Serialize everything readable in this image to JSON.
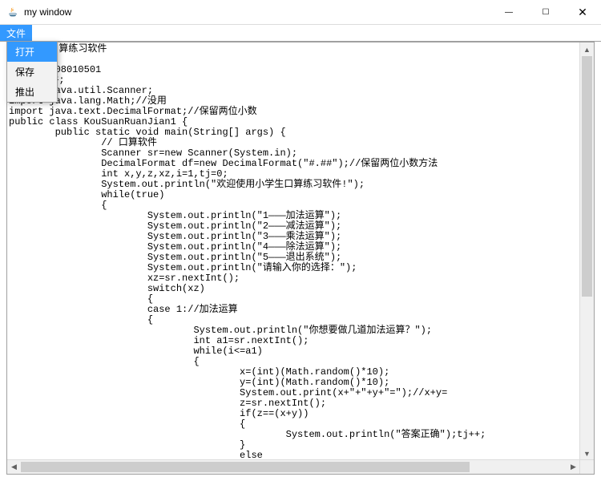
{
  "titlebar": {
    "title": "my window"
  },
  "window_controls": {
    "minimize": "—",
    "maximize": "☐",
    "close": "✕"
  },
  "menubar": {
    "file_label": "文件"
  },
  "dropdown": {
    "open": "打开",
    "save": "保存",
    "exit": "推出"
  },
  "code_text": "//小学生口算练习软件\n//杨子龙\n//20150508010501\n//口算软件;\nimport java.util.Scanner;\nimport java.lang.Math;//没用\nimport java.text.DecimalFormat;//保留两位小数\npublic class KouSuanRuanJian1 {\n        public static void main(String[] args) {\n                // 口算软件\n                Scanner sr=new Scanner(System.in);\n                DecimalFormat df=new DecimalFormat(\"#.##\");//保留两位小数方法\n                int x,y,z,xz,i=1,tj=0;\n                System.out.println(\"欢迎使用小学生口算练习软件!\");\n                while(true)\n                {\n                        System.out.println(\"1———加法运算\");\n                        System.out.println(\"2———减法运算\");\n                        System.out.println(\"3———乘法运算\");\n                        System.out.println(\"4———除法运算\");\n                        System.out.println(\"5———退出系统\");\n                        System.out.println(\"请输入你的选择：\");\n                        xz=sr.nextInt();\n                        switch(xz)\n                        {\n                        case 1://加法运算\n                        {\n                                System.out.println(\"你想要做几道加法运算？\");\n                                int a1=sr.nextInt();\n                                while(i<=a1)\n                                {\n                                        x=(int)(Math.random()*10);\n                                        y=(int)(Math.random()*10);\n                                        System.out.print(x+\"+\"+y+\"=\");//x+y=\n                                        z=sr.nextInt();\n                                        if(z==(x+y))\n                                        {\n                                                System.out.println(\"答案正确\");tj++;\n                                        }\n                                        else\n                                                System.out.println(\"答案错误，正确答案为：\"+x+\"+\"+y+\"=\"+(x\n                                        i++;"
}
